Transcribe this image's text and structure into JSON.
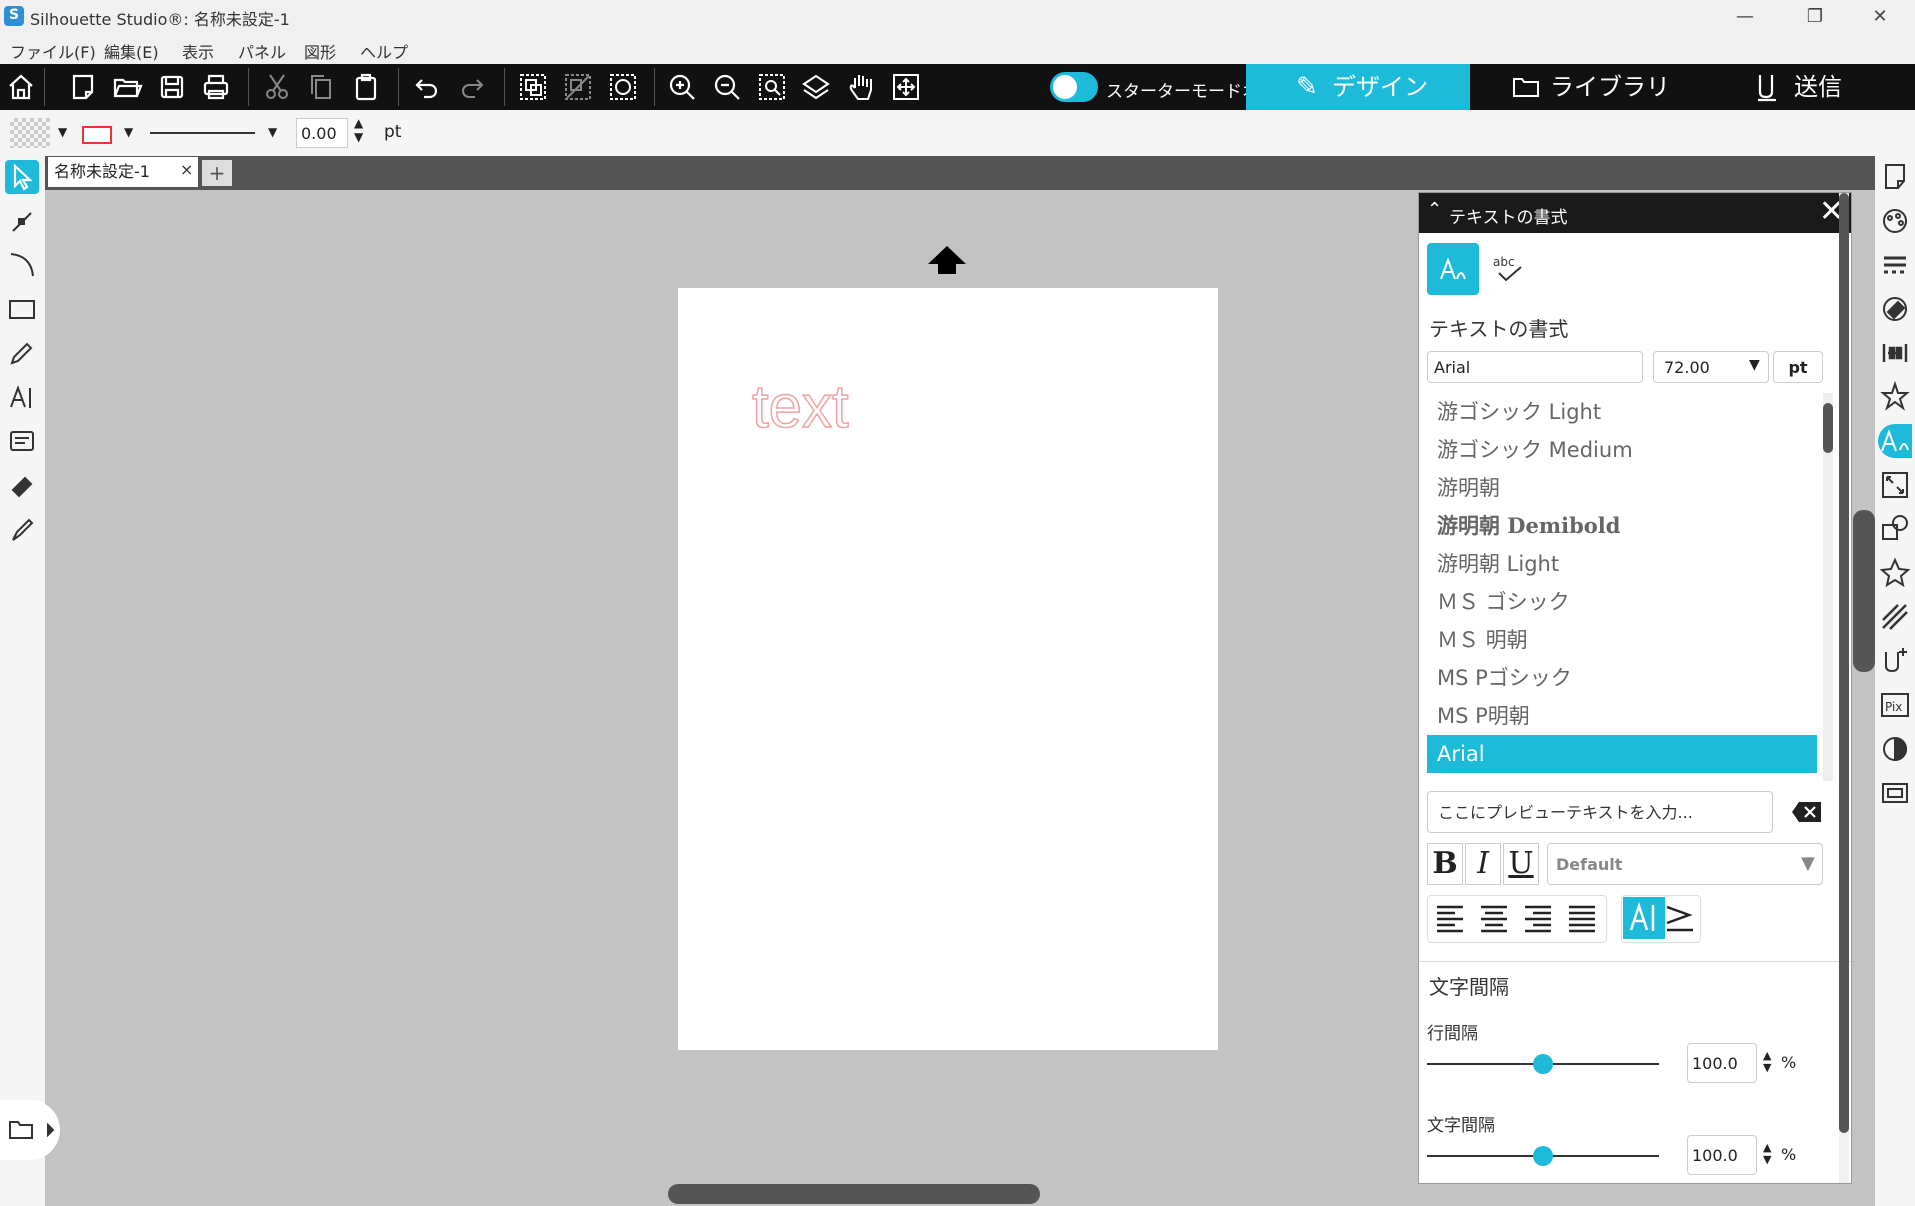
{
  "window": {
    "title": "Silhouette Studio®: 名称未設定-1",
    "minimize": "—",
    "restore": "❐",
    "close": "✕"
  },
  "menu": [
    "ファイル(F)",
    "編集(E)",
    "表示",
    "パネル",
    "図形",
    "ヘルプ"
  ],
  "toolbar": {
    "starter_mode_label": "スターターモードオフ",
    "starter_mode_on": true,
    "tabs": {
      "design": "デザイン",
      "library": "ライブラリ",
      "send": "送信"
    }
  },
  "properties": {
    "line_width": "0.00",
    "line_unit": "pt",
    "line_color": "#e33333"
  },
  "document": {
    "tab_name": "名称未設定-1",
    "tab_close": "×",
    "add_tab": "+",
    "canvas_text": "text"
  },
  "panel": {
    "title": "テキストの書式",
    "section_title": "テキストの書式",
    "font_name": "Arial",
    "font_size": "72.00",
    "font_unit": "pt",
    "fonts": [
      "游ゴシック Light",
      "游ゴシック Medium",
      "游明朝",
      "游明朝 Demibold",
      "游明朝 Light",
      "ＭＳ ゴシック",
      "ＭＳ 明朝",
      "MS Pゴシック",
      "MS P明朝",
      "Arial"
    ],
    "selected_font": "Arial",
    "preview_placeholder": "ここにプレビューテキストを入力...",
    "bold": "B",
    "italic": "I",
    "underline": "U",
    "style_select": "Default",
    "spacing_title": "文字間隔",
    "line_spacing_label": "行間隔",
    "line_spacing_value": "100.0",
    "char_spacing_label": "文字間隔",
    "char_spacing_value": "100.0",
    "percent": "%",
    "line_spacing_level": 0.5,
    "char_spacing_level": 0.5
  },
  "colors": {
    "accent": "#1dbad9",
    "toolbar_bg": "#111111",
    "canvas_bg": "#c3c3c3"
  }
}
